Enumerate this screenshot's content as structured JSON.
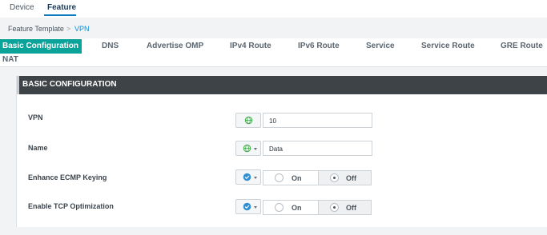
{
  "top_tabs": [
    {
      "label": "Device"
    },
    {
      "label": "Feature"
    }
  ],
  "breadcrumb": {
    "parent": "Feature Template",
    "separator": ">",
    "current": "VPN"
  },
  "sub_tabs": [
    {
      "label": "Basic Configuration",
      "active": true
    },
    {
      "label": "DNS"
    },
    {
      "label": "Advertise OMP"
    },
    {
      "label": "IPv4 Route"
    },
    {
      "label": "IPv6 Route"
    },
    {
      "label": "Service"
    },
    {
      "label": "Service Route"
    },
    {
      "label": "GRE Route"
    },
    {
      "label": "NAT"
    }
  ],
  "section": {
    "title": "BASIC CONFIGURATION",
    "fields": [
      {
        "label": "VPN",
        "scope_icon": "globe-icon",
        "value": "10"
      },
      {
        "label": "Name",
        "scope_icon": "globe-icon",
        "value": "Data"
      },
      {
        "label": "Enhance ECMP Keying",
        "scope_icon": "check-circle-icon",
        "on_label": "On",
        "off_label": "Off",
        "selected": "Off"
      },
      {
        "label": "Enable TCP Optimization",
        "scope_icon": "check-circle-icon",
        "on_label": "On",
        "off_label": "Off",
        "selected": "Off"
      }
    ]
  },
  "colors": {
    "accent_tab": "#0aa39a",
    "link": "#0f8ccf",
    "header_bg": "#3e4348",
    "globe": "#3fae49",
    "check": "#2d8fd5"
  }
}
